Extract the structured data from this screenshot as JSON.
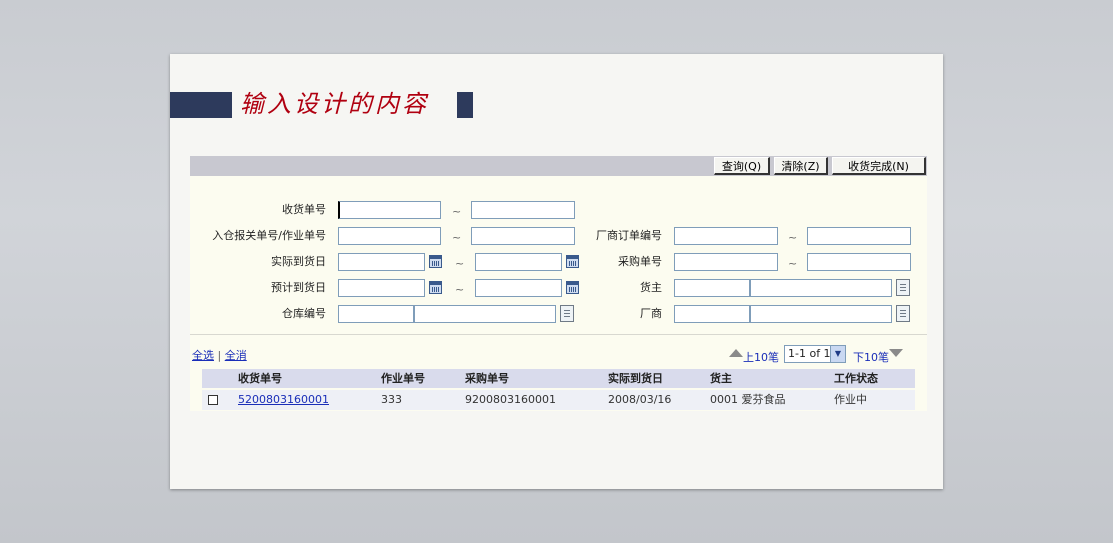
{
  "slide": {
    "title": "输入设计的内容"
  },
  "toolbar": {
    "query_label": "查询(Q)",
    "clear_label": "清除(Z)",
    "complete_label": "收货完成(N)"
  },
  "form": {
    "receipt_no_label": "收货单号",
    "customs_no_label": "入仓报关单号/作业单号",
    "vendor_order_label": "厂商订单编号",
    "arrival_date_label": "实际到货日",
    "purchase_no_label": "采购单号",
    "planned_date_label": "预计到货日",
    "owner_label": "货主",
    "warehouse_label": "仓库编号",
    "vendor_label": "厂商",
    "range_sep": "~"
  },
  "list": {
    "select_all": "全选",
    "separator": "|",
    "clear_all": "全消",
    "prev_label": "上10笔",
    "page_select": "1-1 of 1",
    "next_label": "下10笔",
    "columns": [
      "收货单号",
      "作业单号",
      "采购单号",
      "实际到货日",
      "货主",
      "工作状态"
    ],
    "rows": [
      [
        "5200803160001",
        "333",
        "9200803160001",
        "2008/03/16",
        "0001 爱芬食品",
        "作业中"
      ]
    ]
  },
  "icons": {
    "calendar": "calendar-icon",
    "lookup": "lookup-icon",
    "prev": "arrow-up-icon",
    "next": "arrow-down-icon"
  }
}
